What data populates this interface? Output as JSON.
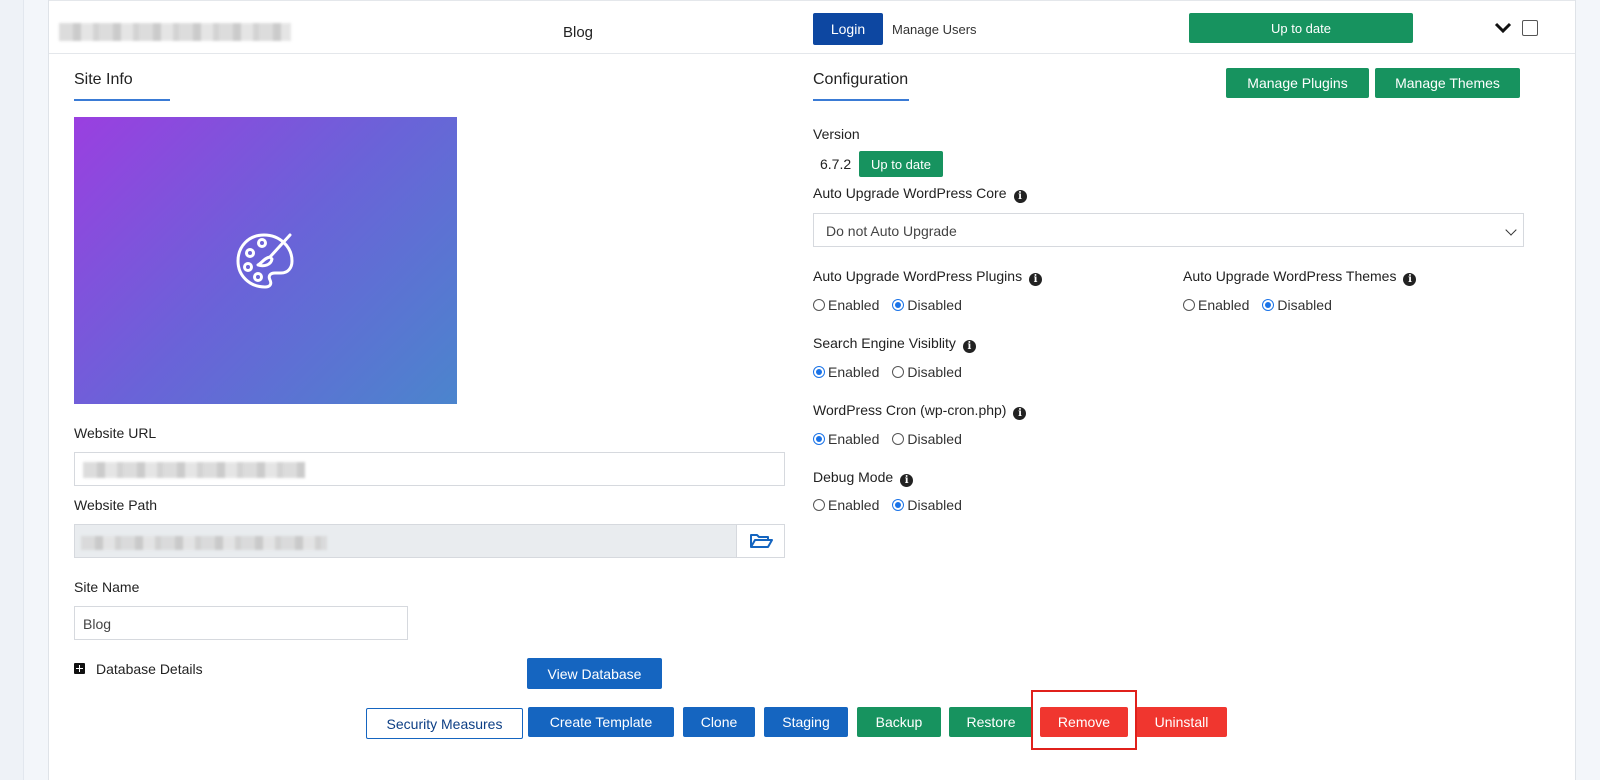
{
  "header": {
    "site_title": "Blog",
    "login_label": "Login",
    "manage_users_label": "Manage Users",
    "status_label": "Up to date"
  },
  "site_info": {
    "heading": "Site Info",
    "website_url_label": "Website URL",
    "website_path_label": "Website Path",
    "site_name_label": "Site Name",
    "site_name_value": "Blog",
    "database_details_label": "Database Details",
    "view_database_label": "View Database"
  },
  "configuration": {
    "heading": "Configuration",
    "manage_plugins_label": "Manage Plugins",
    "manage_themes_label": "Manage Themes",
    "version_label": "Version",
    "version_value": "6.7.2",
    "version_status": "Up to date",
    "auto_upgrade_core_label": "Auto Upgrade WordPress Core",
    "auto_upgrade_core_value": "Do not Auto Upgrade",
    "auto_upgrade_plugins_label": "Auto Upgrade WordPress Plugins",
    "auto_upgrade_themes_label": "Auto Upgrade WordPress Themes",
    "search_visibility_label": "Search Engine Visiblity",
    "cron_label": "WordPress Cron (wp-cron.php)",
    "debug_label": "Debug Mode",
    "enabled_label": "Enabled",
    "disabled_label": "Disabled",
    "settings": {
      "auto_upgrade_plugins": "Disabled",
      "auto_upgrade_themes": "Disabled",
      "search_visibility": "Enabled",
      "cron": "Enabled",
      "debug": "Disabled"
    }
  },
  "actions": {
    "security_measures": "Security Measures",
    "create_template": "Create Template",
    "clone": "Clone",
    "staging": "Staging",
    "backup": "Backup",
    "restore": "Restore",
    "remove": "Remove",
    "uninstall": "Uninstall"
  },
  "icons": {
    "thumbnail": "palette-icon",
    "expand": "chevron-down-icon",
    "browse": "folder-open-icon",
    "info": "info-icon",
    "database_toggle": "plus-square-icon"
  },
  "colors": {
    "primary_blue": "#1565c0",
    "green": "#17935f",
    "red": "#f0362f",
    "highlight": "#e0201b"
  }
}
